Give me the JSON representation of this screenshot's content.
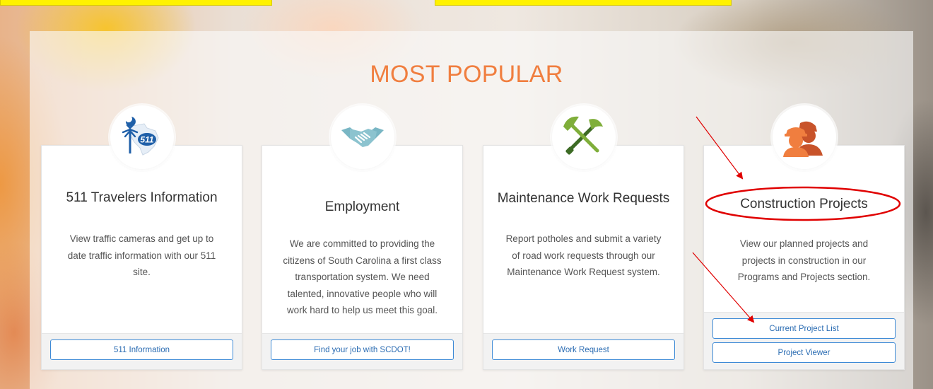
{
  "heading": "MOST POPULAR",
  "colors": {
    "accent": "#f07e3f",
    "button_border": "#3d8ad6",
    "annotation": "#e00000",
    "highlight": "#fff200"
  },
  "cards": [
    {
      "icon": "sc-511-map-icon",
      "title": "511 Travelers Information",
      "description_lines": [
        "View traffic cameras and get up to",
        "date traffic information with our 511",
        "site."
      ],
      "buttons": [
        "511 Information"
      ]
    },
    {
      "icon": "handshake-icon",
      "title": "Employment",
      "description_lines": [
        "We are committed to providing the",
        "citizens of South Carolina a first class",
        "transportation system. We need",
        "talented, innovative people who will",
        "work hard to help us meet this goal."
      ],
      "buttons": [
        "Find your job with SCDOT!"
      ]
    },
    {
      "icon": "shovel-pickaxe-icon",
      "title": "Maintenance Work Requests",
      "description_lines": [
        "Report potholes and submit a variety",
        "of road work requests through our",
        "Maintenance Work Request system."
      ],
      "buttons": [
        "Work Request"
      ]
    },
    {
      "icon": "construction-workers-icon",
      "title": "Construction Projects",
      "description_lines": [
        "View our planned projects and",
        "projects in construction in our",
        "Programs and Projects section."
      ],
      "buttons": [
        "Current Project List",
        "Project Viewer"
      ]
    }
  ]
}
